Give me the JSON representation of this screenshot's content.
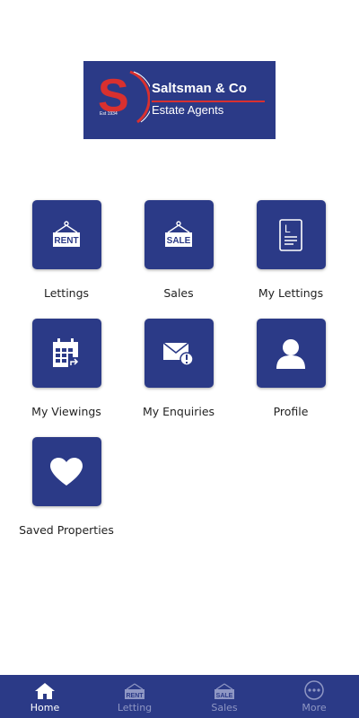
{
  "brand": {
    "name": "Saltsman & Co",
    "tagline": "Estate Agents",
    "established": "Est 1934",
    "letter": "S",
    "colors": {
      "navy": "#2b3a87",
      "red": "#d9302f"
    }
  },
  "tiles": [
    {
      "label": "Lettings",
      "icon": "rent-sign-icon",
      "icon_text": "RENT"
    },
    {
      "label": "Sales",
      "icon": "sale-sign-icon",
      "icon_text": "SALE"
    },
    {
      "label": "My Lettings",
      "icon": "document-icon",
      "icon_text": "L"
    },
    {
      "label": "My Viewings",
      "icon": "calendar-icon"
    },
    {
      "label": "My Enquiries",
      "icon": "envelope-alert-icon"
    },
    {
      "label": "Profile",
      "icon": "user-icon"
    },
    {
      "label": "Saved Properties",
      "icon": "heart-icon"
    }
  ],
  "bottom_nav": [
    {
      "label": "Home",
      "icon": "home-icon",
      "active": true
    },
    {
      "label": "Letting",
      "icon": "rent-sign-icon",
      "icon_text": "RENT",
      "active": false
    },
    {
      "label": "Sales",
      "icon": "sale-sign-icon",
      "icon_text": "SALE",
      "active": false
    },
    {
      "label": "More",
      "icon": "more-icon",
      "active": false
    }
  ]
}
